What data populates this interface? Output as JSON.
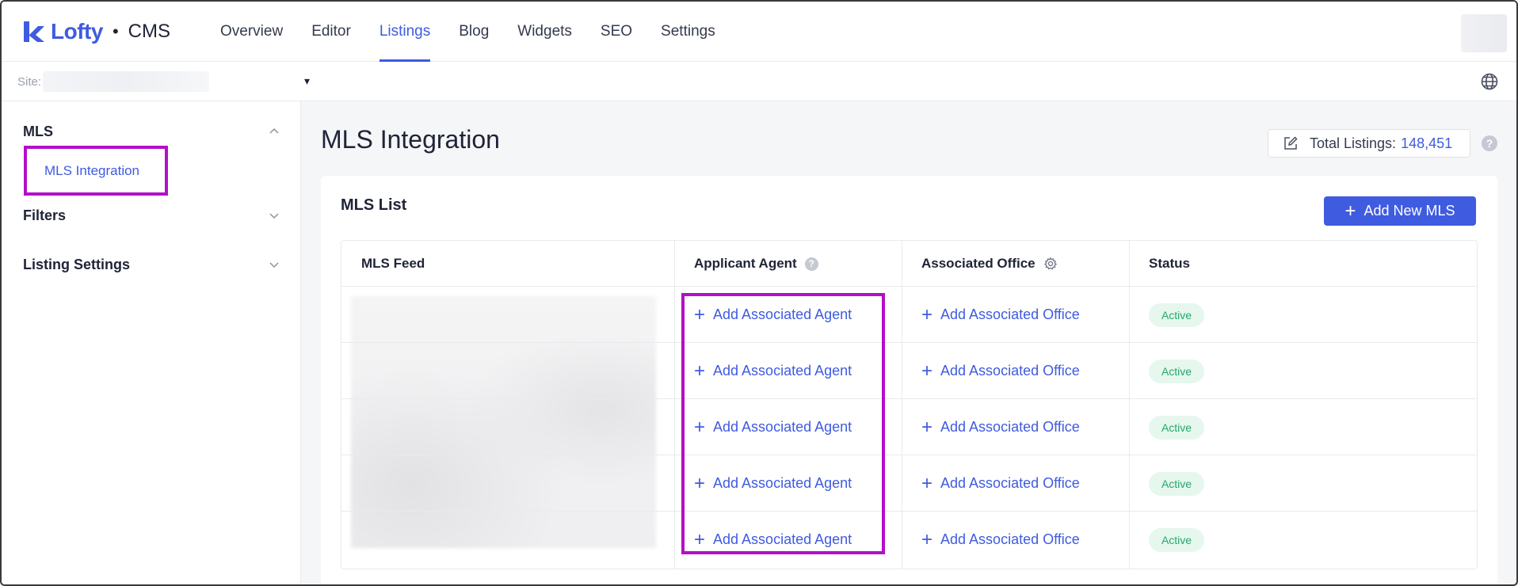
{
  "header": {
    "brand": "Lofty",
    "separator": "•",
    "product": "CMS",
    "nav": [
      {
        "label": "Overview",
        "active": false
      },
      {
        "label": "Editor",
        "active": false
      },
      {
        "label": "Listings",
        "active": true
      },
      {
        "label": "Blog",
        "active": false
      },
      {
        "label": "Widgets",
        "active": false
      },
      {
        "label": "SEO",
        "active": false
      },
      {
        "label": "Settings",
        "active": false
      }
    ]
  },
  "sitebar": {
    "label": "Site:",
    "caret": "▾"
  },
  "sidebar": {
    "groups": [
      {
        "label": "MLS",
        "expanded": true
      },
      {
        "label": "Filters",
        "expanded": false
      },
      {
        "label": "Listing Settings",
        "expanded": false
      }
    ],
    "sub_item": "MLS Integration"
  },
  "main": {
    "title": "MLS Integration",
    "total_label": "Total Listings:",
    "total_value": "148,451",
    "help": "?"
  },
  "card": {
    "title": "MLS List",
    "add_button": "Add New MLS",
    "columns": {
      "feed": "MLS Feed",
      "agent": "Applicant Agent",
      "office": "Associated Office",
      "status": "Status"
    },
    "rows": [
      {
        "agent": "Add Associated Agent",
        "office": "Add Associated Office",
        "status": "Active"
      },
      {
        "agent": "Add Associated Agent",
        "office": "Add Associated Office",
        "status": "Active"
      },
      {
        "agent": "Add Associated Agent",
        "office": "Add Associated Office",
        "status": "Active"
      },
      {
        "agent": "Add Associated Agent",
        "office": "Add Associated Office",
        "status": "Active"
      },
      {
        "agent": "Add Associated Agent",
        "office": "Add Associated Office",
        "status": "Active"
      }
    ]
  },
  "colors": {
    "accent": "#3f5be0",
    "highlight": "#b30fc9",
    "active_badge_bg": "#e6f7ee",
    "active_badge_text": "#26a86a"
  }
}
